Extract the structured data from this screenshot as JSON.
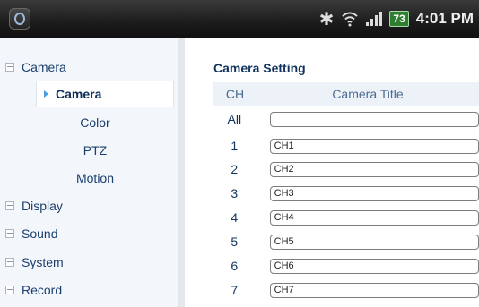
{
  "status_bar": {
    "app_icon": "camera-app-icon",
    "bluetooth_icon": "bluetooth-icon",
    "wifi_icon": "wifi-icon",
    "signal_icon": "signal-icon",
    "battery_level": "73",
    "time": "4:01 PM"
  },
  "sidebar": {
    "groups": [
      {
        "label": "Camera"
      },
      {
        "label": "Display"
      },
      {
        "label": "Sound"
      },
      {
        "label": "System"
      },
      {
        "label": "Record"
      }
    ],
    "camera_sub": [
      {
        "label": "Camera",
        "active": true
      },
      {
        "label": "Color"
      },
      {
        "label": "PTZ"
      },
      {
        "label": "Motion"
      }
    ]
  },
  "main": {
    "title": "Camera Setting",
    "headers": {
      "ch": "CH",
      "title": "Camera Title"
    },
    "rows": [
      {
        "ch": "All",
        "value": ""
      },
      {
        "ch": "1",
        "value": "CH1"
      },
      {
        "ch": "2",
        "value": "CH2"
      },
      {
        "ch": "3",
        "value": "CH3"
      },
      {
        "ch": "4",
        "value": "CH4"
      },
      {
        "ch": "5",
        "value": "CH5"
      },
      {
        "ch": "6",
        "value": "CH6"
      },
      {
        "ch": "7",
        "value": "CH7"
      }
    ]
  },
  "colors": {
    "accent": "#4b9fe0",
    "text": "#1a3f6d",
    "header_bg": "#edf2f8"
  }
}
